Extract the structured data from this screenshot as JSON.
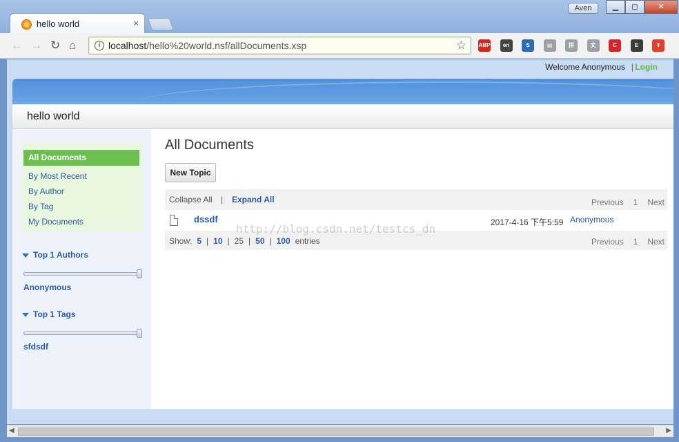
{
  "browser": {
    "tab_title": "hello world",
    "tab_close": "×",
    "user_name": "Aven",
    "window_buttons": {
      "minimize": "▁",
      "maximize": "◻",
      "close": "✕"
    },
    "nav": {
      "back": "←",
      "forward": "→",
      "reload": "↻",
      "home": "⌂"
    },
    "url_host": "localhost",
    "url_path": "/hello%20world.nsf/allDocuments.xsp",
    "info_glyph": "i",
    "star": "☆",
    "extensions": [
      {
        "name": "adblock-plus-icon",
        "label": "ABP",
        "color": "#d9251d"
      },
      {
        "name": "translate-icon",
        "label": "en",
        "color": "#444444"
      },
      {
        "name": "s-extension-icon",
        "label": "S",
        "color": "#2b6db3"
      },
      {
        "name": "reader-icon",
        "label": "▤",
        "color": "#9aa0a6"
      },
      {
        "name": "pinyin-icon",
        "label": "拼",
        "color": "#9aa0a6"
      },
      {
        "name": "dictionary-icon",
        "label": "文",
        "color": "#9aa0a6"
      },
      {
        "name": "c-extension-icon",
        "label": "C",
        "color": "#d7262b"
      },
      {
        "name": "evernote-icon",
        "label": "E",
        "color": "#3b3b3b"
      },
      {
        "name": "upload-icon",
        "label": "⬆",
        "color": "#e0402a"
      }
    ]
  },
  "header": {
    "welcome": "Welcome Anonymous",
    "separator": "|",
    "login": "Login",
    "app_title": "hello world"
  },
  "sidebar": {
    "nav": [
      {
        "label": "All Documents",
        "active": true
      },
      {
        "label": "By Most Recent"
      },
      {
        "label": "By Author"
      },
      {
        "label": "By Tag"
      },
      {
        "label": "My Documents"
      }
    ],
    "authors": {
      "title": "Top 1 Authors",
      "items": [
        "Anonymous"
      ]
    },
    "tags": {
      "title": "Top 1 Tags",
      "items": [
        "sfdsdf"
      ]
    }
  },
  "main": {
    "title": "All Documents",
    "new_topic": "New Topic",
    "collapse_all": "Collapse All",
    "pipe": "|",
    "expand_all": "Expand All",
    "pager": {
      "previous": "Previous",
      "page": "1",
      "next": "Next"
    },
    "rows": [
      {
        "title": "dssdf",
        "date": "2017-4-16 下午5:59",
        "author": "Anonymous"
      }
    ],
    "show": {
      "label": "Show:",
      "options": [
        "5",
        "10",
        "25",
        "50",
        "100"
      ],
      "separator": "|",
      "entries": "entries"
    },
    "watermark": "http://blog.csdn.net/testcs_dn"
  },
  "colors": {
    "accent_green": "#6cbf4e",
    "link_blue": "#2d5aa5",
    "banner_blue": "#5591db"
  }
}
